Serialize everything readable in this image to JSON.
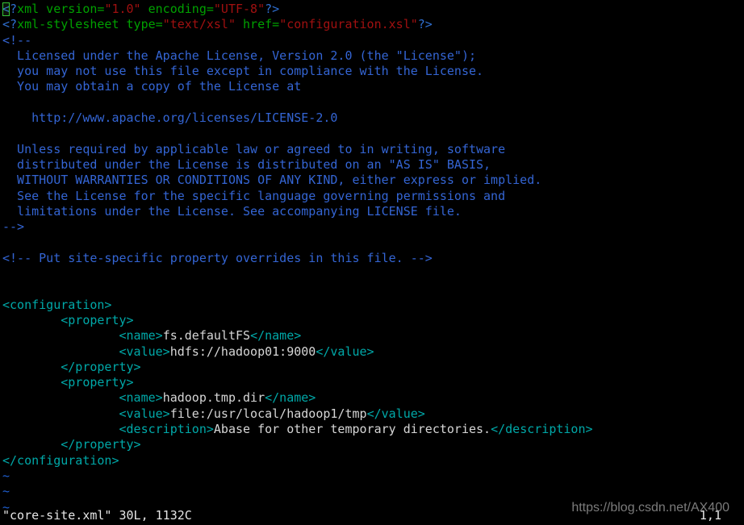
{
  "editor": {
    "name": "vim",
    "background": "#000000",
    "cursor_color": "#35c435",
    "colors": {
      "comment": "#3465d4",
      "pi_delimiter": "#2f6fd0",
      "pi_name": "#00a000",
      "attr_string": "#a01010",
      "tag": "#00a8a8",
      "text": "#d6d6d6",
      "tilde": "#1f5fd0",
      "status": "#e6e6e6"
    }
  },
  "lines": [
    {
      "id": 1,
      "segments": [
        {
          "t": "<?",
          "c": "c-pi"
        },
        {
          "t": "xml version=",
          "c": "c-tagname"
        },
        {
          "t": "\"1.0\"",
          "c": "c-string"
        },
        {
          "t": " encoding=",
          "c": "c-tagname"
        },
        {
          "t": "\"UTF-8\"",
          "c": "c-string"
        },
        {
          "t": "?>",
          "c": "c-pi"
        }
      ]
    },
    {
      "id": 2,
      "segments": [
        {
          "t": "<?",
          "c": "c-pi"
        },
        {
          "t": "xml-stylesheet type=",
          "c": "c-tagname"
        },
        {
          "t": "\"text/xsl\"",
          "c": "c-string"
        },
        {
          "t": " href=",
          "c": "c-tagname"
        },
        {
          "t": "\"configuration.xsl\"",
          "c": "c-string"
        },
        {
          "t": "?>",
          "c": "c-pi"
        }
      ]
    },
    {
      "id": 3,
      "segments": [
        {
          "t": "<!--",
          "c": "c-comment"
        }
      ]
    },
    {
      "id": 4,
      "segments": [
        {
          "t": "  Licensed under the Apache License, Version 2.0 (the \"License\");",
          "c": "c-comment"
        }
      ]
    },
    {
      "id": 5,
      "segments": [
        {
          "t": "  you may not use this file except in compliance with the License.",
          "c": "c-comment"
        }
      ]
    },
    {
      "id": 6,
      "segments": [
        {
          "t": "  You may obtain a copy of the License at",
          "c": "c-comment"
        }
      ]
    },
    {
      "id": 7,
      "segments": [
        {
          "t": "",
          "c": "c-comment"
        }
      ]
    },
    {
      "id": 8,
      "segments": [
        {
          "t": "    http://www.apache.org/licenses/LICENSE-2.0",
          "c": "c-comment"
        }
      ]
    },
    {
      "id": 9,
      "segments": [
        {
          "t": "",
          "c": "c-comment"
        }
      ]
    },
    {
      "id": 10,
      "segments": [
        {
          "t": "  Unless required by applicable law or agreed to in writing, software",
          "c": "c-comment"
        }
      ]
    },
    {
      "id": 11,
      "segments": [
        {
          "t": "  distributed under the License is distributed on an \"AS IS\" BASIS,",
          "c": "c-comment"
        }
      ]
    },
    {
      "id": 12,
      "segments": [
        {
          "t": "  WITHOUT WARRANTIES OR CONDITIONS OF ANY KIND, either express or implied.",
          "c": "c-comment"
        }
      ]
    },
    {
      "id": 13,
      "segments": [
        {
          "t": "  See the License for the specific language governing permissions and",
          "c": "c-comment"
        }
      ]
    },
    {
      "id": 14,
      "segments": [
        {
          "t": "  limitations under the License. See accompanying LICENSE file.",
          "c": "c-comment"
        }
      ]
    },
    {
      "id": 15,
      "segments": [
        {
          "t": "-->",
          "c": "c-comment"
        }
      ]
    },
    {
      "id": 16,
      "segments": [
        {
          "t": "",
          "c": "c-text"
        }
      ]
    },
    {
      "id": 17,
      "segments": [
        {
          "t": "<!-- Put site-specific property overrides in this file. -->",
          "c": "c-comment"
        }
      ]
    },
    {
      "id": 18,
      "segments": [
        {
          "t": "",
          "c": "c-text"
        }
      ]
    },
    {
      "id": 19,
      "segments": [
        {
          "t": "",
          "c": "c-text"
        }
      ]
    },
    {
      "id": 20,
      "segments": [
        {
          "t": "<configuration>",
          "c": "c-tag"
        }
      ]
    },
    {
      "id": 21,
      "segments": [
        {
          "t": "        <property>",
          "c": "c-tag"
        }
      ]
    },
    {
      "id": 22,
      "segments": [
        {
          "t": "                <name>",
          "c": "c-tag"
        },
        {
          "t": "fs.defaultFS",
          "c": "c-text"
        },
        {
          "t": "</name>",
          "c": "c-tag"
        }
      ]
    },
    {
      "id": 23,
      "segments": [
        {
          "t": "                <value>",
          "c": "c-tag"
        },
        {
          "t": "hdfs://hadoop01:9000",
          "c": "c-text"
        },
        {
          "t": "</value>",
          "c": "c-tag"
        }
      ]
    },
    {
      "id": 24,
      "segments": [
        {
          "t": "        </property>",
          "c": "c-tag"
        }
      ]
    },
    {
      "id": 25,
      "segments": [
        {
          "t": "        <property>",
          "c": "c-tag"
        }
      ]
    },
    {
      "id": 26,
      "segments": [
        {
          "t": "                <name>",
          "c": "c-tag"
        },
        {
          "t": "hadoop.tmp.dir",
          "c": "c-text"
        },
        {
          "t": "</name>",
          "c": "c-tag"
        }
      ]
    },
    {
      "id": 27,
      "segments": [
        {
          "t": "                <value>",
          "c": "c-tag"
        },
        {
          "t": "file:/usr/local/hadoop1/tmp",
          "c": "c-text"
        },
        {
          "t": "</value>",
          "c": "c-tag"
        }
      ]
    },
    {
      "id": 28,
      "segments": [
        {
          "t": "                <description>",
          "c": "c-tag"
        },
        {
          "t": "Abase for other temporary directories.",
          "c": "c-text"
        },
        {
          "t": "</description>",
          "c": "c-tag"
        }
      ]
    },
    {
      "id": 29,
      "segments": [
        {
          "t": "        </property>",
          "c": "c-tag"
        }
      ]
    },
    {
      "id": 30,
      "segments": [
        {
          "t": "</configuration>",
          "c": "c-tag"
        }
      ]
    },
    {
      "id": 31,
      "segments": [
        {
          "t": "~",
          "c": "c-tilde"
        }
      ]
    },
    {
      "id": 32,
      "segments": [
        {
          "t": "~",
          "c": "c-tilde"
        }
      ]
    },
    {
      "id": 33,
      "segments": [
        {
          "t": "~",
          "c": "c-tilde"
        }
      ]
    }
  ],
  "status": {
    "file_label": "\"core-site.xml\" 30L, 1132C",
    "filename": "core-site.xml",
    "line_count": "30L",
    "char_count": "1132C",
    "cursor_position": "1,1"
  },
  "watermark": {
    "text": "https://blog.csdn.net/AX400"
  }
}
